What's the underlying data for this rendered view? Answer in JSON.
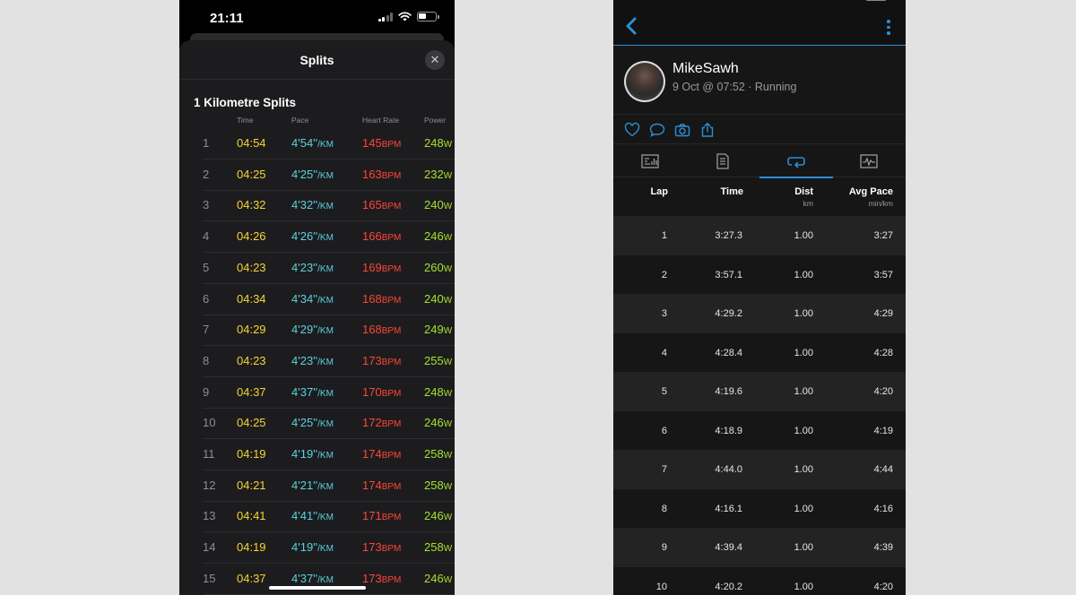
{
  "left": {
    "status": {
      "time": "21:11"
    },
    "sheet_title": "Splits",
    "section_title": "1 Kilometre Splits",
    "columns": [
      "Time",
      "Pace",
      "Heart Rate",
      "Power"
    ],
    "splits": [
      {
        "n": "1",
        "time": "04:54",
        "pace": "4'54''",
        "hr": "145",
        "power": "248"
      },
      {
        "n": "2",
        "time": "04:25",
        "pace": "4'25''",
        "hr": "163",
        "power": "232"
      },
      {
        "n": "3",
        "time": "04:32",
        "pace": "4'32''",
        "hr": "165",
        "power": "240"
      },
      {
        "n": "4",
        "time": "04:26",
        "pace": "4'26''",
        "hr": "166",
        "power": "246"
      },
      {
        "n": "5",
        "time": "04:23",
        "pace": "4'23''",
        "hr": "169",
        "power": "260"
      },
      {
        "n": "6",
        "time": "04:34",
        "pace": "4'34''",
        "hr": "168",
        "power": "240"
      },
      {
        "n": "7",
        "time": "04:29",
        "pace": "4'29''",
        "hr": "168",
        "power": "249"
      },
      {
        "n": "8",
        "time": "04:23",
        "pace": "4'23''",
        "hr": "173",
        "power": "255"
      },
      {
        "n": "9",
        "time": "04:37",
        "pace": "4'37''",
        "hr": "170",
        "power": "248"
      },
      {
        "n": "10",
        "time": "04:25",
        "pace": "4'25''",
        "hr": "172",
        "power": "246"
      },
      {
        "n": "11",
        "time": "04:19",
        "pace": "4'19''",
        "hr": "174",
        "power": "258"
      },
      {
        "n": "12",
        "time": "04:21",
        "pace": "4'21''",
        "hr": "174",
        "power": "258"
      },
      {
        "n": "13",
        "time": "04:41",
        "pace": "4'41''",
        "hr": "171",
        "power": "246"
      },
      {
        "n": "14",
        "time": "04:19",
        "pace": "4'19''",
        "hr": "173",
        "power": "258"
      },
      {
        "n": "15",
        "time": "04:37",
        "pace": "4'37''",
        "hr": "173",
        "power": "246"
      }
    ],
    "units": {
      "pace": "/KM",
      "hr": "BPM",
      "power": "W"
    },
    "colors": {
      "time": "#f5d530",
      "pace": "#5ad2e0",
      "hr": "#ff453a",
      "power": "#a6e22e"
    }
  },
  "right": {
    "user_name": "MikeSawh",
    "activity_meta": "9 Oct @ 07:52 · Running",
    "accent": "#2b8fd6",
    "actions": [
      "heart-icon",
      "comment-icon",
      "camera-icon",
      "share-icon"
    ],
    "tabs": [
      "stats-tab-icon",
      "details-tab-icon",
      "laps-tab-icon",
      "chart-tab-icon"
    ],
    "active_tab": 2,
    "headers": {
      "lap": "Lap",
      "time": "Time",
      "dist": "Dist",
      "dist_unit": "km",
      "pace": "Avg Pace",
      "pace_unit": "min/km"
    },
    "laps": [
      {
        "lap": "1",
        "time": "3:27.3",
        "dist": "1.00",
        "pace": "3:27"
      },
      {
        "lap": "2",
        "time": "3:57.1",
        "dist": "1.00",
        "pace": "3:57"
      },
      {
        "lap": "3",
        "time": "4:29.2",
        "dist": "1.00",
        "pace": "4:29"
      },
      {
        "lap": "4",
        "time": "4:28.4",
        "dist": "1.00",
        "pace": "4:28"
      },
      {
        "lap": "5",
        "time": "4:19.6",
        "dist": "1.00",
        "pace": "4:20"
      },
      {
        "lap": "6",
        "time": "4:18.9",
        "dist": "1.00",
        "pace": "4:19"
      },
      {
        "lap": "7",
        "time": "4:44.0",
        "dist": "1.00",
        "pace": "4:44"
      },
      {
        "lap": "8",
        "time": "4:16.1",
        "dist": "1.00",
        "pace": "4:16"
      },
      {
        "lap": "9",
        "time": "4:39.4",
        "dist": "1.00",
        "pace": "4:39"
      },
      {
        "lap": "10",
        "time": "4:20.2",
        "dist": "1.00",
        "pace": "4:20"
      }
    ]
  }
}
